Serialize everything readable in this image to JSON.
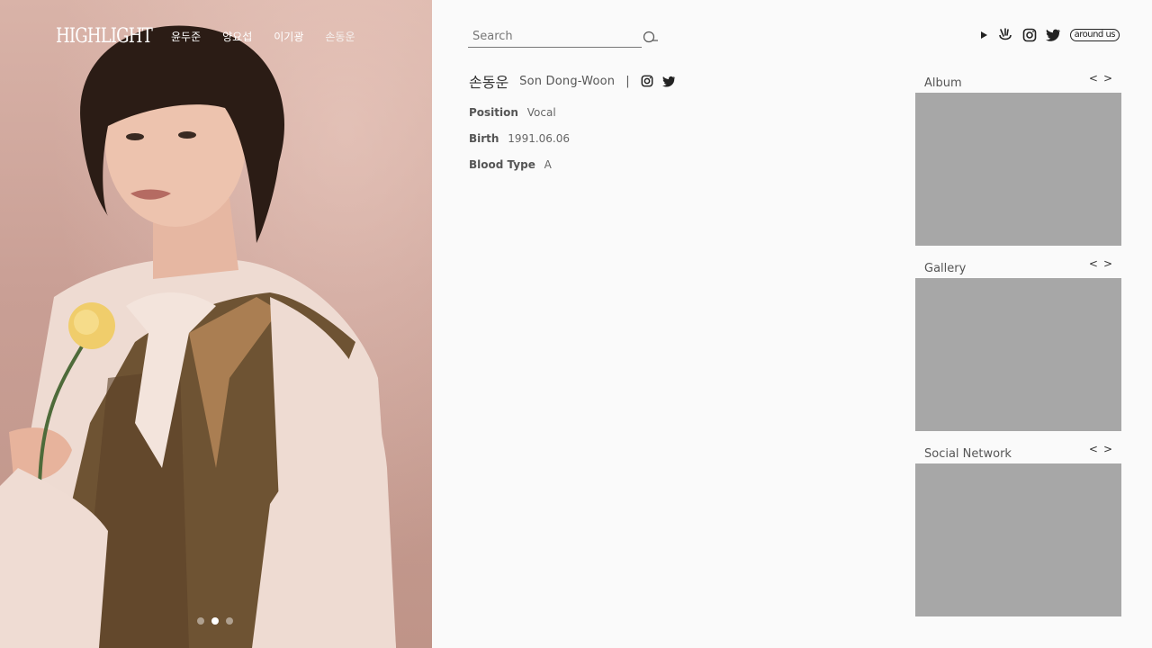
{
  "hero": {
    "logo": "HIGHLIGHT",
    "nav": [
      {
        "label": "윤두준",
        "active": false
      },
      {
        "label": "양요섭",
        "active": false
      },
      {
        "label": "이기광",
        "active": false
      },
      {
        "label": "손동운",
        "active": true
      }
    ],
    "carousel": {
      "count": 3,
      "active_index": 1
    }
  },
  "search": {
    "placeholder": "Search",
    "value": ""
  },
  "top_icons": [
    "play-icon",
    "vlive-icon",
    "instagram-icon",
    "twitter-icon",
    "around-us-logo"
  ],
  "around_us_text": "around us",
  "profile": {
    "korean_name": "손동운",
    "english_name": "Son Dong-Woon",
    "separator": "|",
    "social_icons": [
      "instagram-icon",
      "twitter-icon"
    ],
    "fields": [
      {
        "label": "Position",
        "value": "Vocal"
      },
      {
        "label": "Birth",
        "value": "1991.06.06"
      },
      {
        "label": "Blood Type",
        "value": "A"
      }
    ]
  },
  "cards": [
    {
      "title": "Album",
      "prev": "<",
      "next": ">"
    },
    {
      "title": "Gallery",
      "prev": "<",
      "next": ">"
    },
    {
      "title": "Social Network",
      "prev": "<",
      "next": ">"
    }
  ],
  "colors": {
    "placeholder_box": "#a7a7a7",
    "background": "#fafafa",
    "hero_wall": "#d9b3a8"
  }
}
